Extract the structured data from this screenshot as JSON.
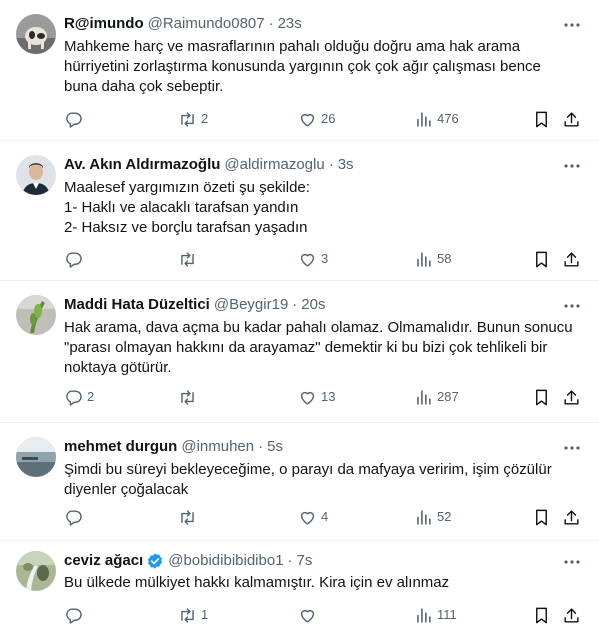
{
  "tweets": [
    {
      "name": "R@imundo",
      "handle": "@Raimundo0807",
      "time": "23s",
      "verified": false,
      "text": "Mahkeme harç ve masraflarının pahalı olduğu doğru ama hak arama hürriyetini zorlaştırma konusunda yargının çok çok ağır çalışması bence buna daha çok sebeptir.",
      "replies": "",
      "retweets": "2",
      "likes": "26",
      "views": "476"
    },
    {
      "name": "Av. Akın Aldırmazoğlu",
      "handle": "@aldirmazoglu",
      "time": "3s",
      "verified": false,
      "text": "Maalesef yargımızın özeti şu şekilde:\n1- Haklı ve alacaklı tarafsan yandın\n2- Haksız ve borçlu tarafsan yaşadın",
      "replies": "",
      "retweets": "",
      "likes": "3",
      "views": "58"
    },
    {
      "name": "Maddi Hata Düzeltici",
      "handle": "@Beygir19",
      "time": "20s",
      "verified": false,
      "text": "Hak arama, dava açma bu kadar pahalı olamaz. Olmamalıdır. Bunun sonucu \"parası olmayan hakkını da arayamaz\" demektir ki bu bizi çok tehlikeli bir noktaya götürür.",
      "replies": "2",
      "retweets": "",
      "likes": "13",
      "views": "287"
    },
    {
      "name": "mehmet durgun",
      "handle": "@inmuhen",
      "time": "5s",
      "verified": false,
      "text": "Şimdi bu süreyi bekleyeceğime,  o parayı da mafyaya veririm,  işim çözülür diyenler çoğalacak",
      "replies": "",
      "retweets": "",
      "likes": "4",
      "views": "52"
    },
    {
      "name": "ceviz ağacı",
      "handle": "@bobidibibidibo1",
      "time": "7s",
      "verified": true,
      "text": "Bu ülkede mülkiyet hakkı kalmamıştır. Kira için ev alınmaz",
      "replies": "",
      "retweets": "1",
      "likes": "",
      "views": "111"
    }
  ],
  "separator": "·",
  "colors": {
    "text": "#0f1419",
    "secondary": "#536471",
    "divider": "#eff3f4",
    "verified": "#1d9bf0"
  },
  "icons": [
    "more-icon",
    "reply-icon",
    "retweet-icon",
    "like-icon",
    "views-icon",
    "bookmark-icon",
    "share-icon",
    "verified-icon"
  ]
}
